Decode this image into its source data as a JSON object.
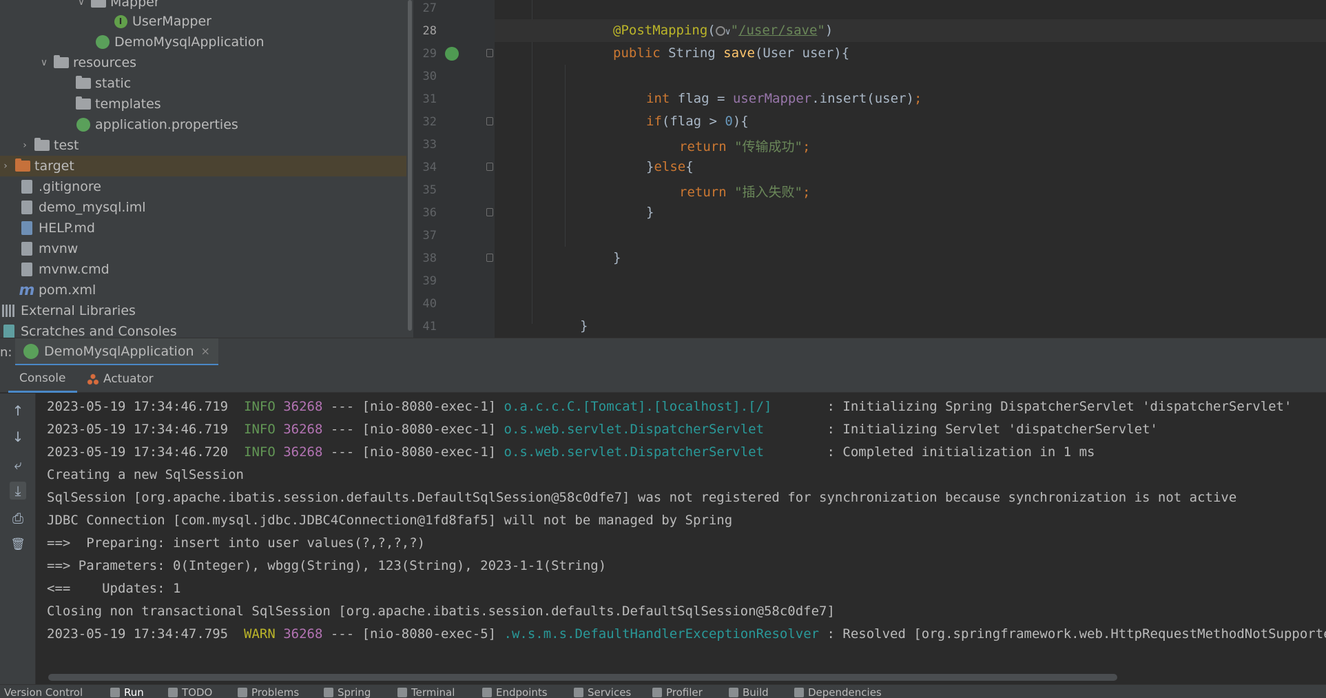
{
  "project_tree": {
    "items": [
      {
        "label": "Mapper",
        "arrow": "∨",
        "icon": "folder-icon"
      },
      {
        "label": "UserMapper",
        "arrow": "",
        "icon": "interface-icon",
        "icon_text": "I"
      },
      {
        "label": "DemoMysqlApplication",
        "arrow": "",
        "icon": "spring-boot-class-icon"
      },
      {
        "label": "resources",
        "arrow": "∨",
        "icon": "resources-folder-icon"
      },
      {
        "label": "static",
        "arrow": "",
        "icon": "folder-icon"
      },
      {
        "label": "templates",
        "arrow": "",
        "icon": "folder-icon"
      },
      {
        "label": "application.properties",
        "arrow": "",
        "icon": "spring-properties-icon"
      },
      {
        "label": "test",
        "arrow": "›",
        "icon": "folder-icon"
      },
      {
        "label": "target",
        "arrow": "›",
        "icon": "excluded-folder-icon"
      },
      {
        "label": ".gitignore",
        "arrow": "",
        "icon": "file-icon"
      },
      {
        "label": "demo_mysql.iml",
        "arrow": "",
        "icon": "file-icon"
      },
      {
        "label": "HELP.md",
        "arrow": "",
        "icon": "markdown-icon"
      },
      {
        "label": "mvnw",
        "arrow": "",
        "icon": "script-icon"
      },
      {
        "label": "mvnw.cmd",
        "arrow": "",
        "icon": "file-icon"
      },
      {
        "label": "pom.xml",
        "arrow": "",
        "icon": "maven-icon",
        "icon_text": "m"
      },
      {
        "label": "External Libraries",
        "arrow": "",
        "icon": "libraries-icon"
      },
      {
        "label": "Scratches and Consoles",
        "arrow": "",
        "icon": "scratches-icon"
      }
    ],
    "selected": "target"
  },
  "editor": {
    "line_numbers": [
      "27",
      "28",
      "29",
      "30",
      "31",
      "32",
      "33",
      "34",
      "35",
      "36",
      "37",
      "38",
      "39",
      "40",
      "41"
    ],
    "current_line": "28",
    "code": {
      "l28_annotation": "@PostMapping",
      "l28_open": "(",
      "l28_dropdown": "∨",
      "l28_quote1": "\"",
      "l28_url1": "/user/",
      "l28_url2": "save",
      "l28_quote2": "\"",
      "l28_close": ")",
      "l29_public": "public",
      "l29_type": " String ",
      "l29_method": "save",
      "l29_params": "(User user){",
      "l31_int": "int",
      "l31_rest1": " flag = ",
      "l31_field": "userMapper",
      "l31_rest2": ".insert(user)",
      "l31_semi": ";",
      "l32_if": "if",
      "l32_rest1": "(flag > ",
      "l32_num": "0",
      "l32_rest2": "){",
      "l33_return": "return",
      "l33_str": " \"传输成功\"",
      "l33_semi": ";",
      "l34_brace": "}",
      "l34_else": "else",
      "l34_open": "{",
      "l35_return": "return",
      "l35_str": " \"插入失败\"",
      "l35_semi": ";",
      "l36_brace": "}",
      "l38_brace": "}",
      "l41_brace": "}"
    }
  },
  "run_window": {
    "prefix": "n:",
    "tab_label": "DemoMysqlApplication",
    "tab_close": "×",
    "sub_tabs": [
      "Console",
      "Actuator"
    ]
  },
  "console_toolbar": {
    "up": "↑",
    "down": "↓",
    "wrap": "⤶",
    "scroll_end": "⤓",
    "print": "⎙",
    "clear": "🗑"
  },
  "console": {
    "log": [
      {
        "ts": "2023-05-19 17:34:46.719",
        "level": "INFO",
        "pid": "36268",
        "thread": " --- [nio-8080-exec-1] ",
        "logger": "o.a.c.c.C.[Tomcat].[localhost].[/]      ",
        "msg": " : Initializing Spring DispatcherServlet 'dispatcherServlet'"
      },
      {
        "ts": "2023-05-19 17:34:46.719",
        "level": "INFO",
        "pid": "36268",
        "thread": " --- [nio-8080-exec-1] ",
        "logger": "o.s.web.servlet.DispatcherServlet       ",
        "msg": " : Initializing Servlet 'dispatcherServlet'"
      },
      {
        "ts": "2023-05-19 17:34:46.720",
        "level": "INFO",
        "pid": "36268",
        "thread": " --- [nio-8080-exec-1] ",
        "logger": "o.s.web.servlet.DispatcherServlet       ",
        "msg": " : Completed initialization in 1 ms"
      }
    ],
    "plain": [
      "Creating a new SqlSession",
      "SqlSession [org.apache.ibatis.session.defaults.DefaultSqlSession@58c0dfe7] was not registered for synchronization because synchronization is not active",
      "JDBC Connection [com.mysql.jdbc.JDBC4Connection@1fd8faf5] will not be managed by Spring",
      "==>  Preparing: insert into user values(?,?,?,?)",
      "==> Parameters: 0(Integer), wbgg(String), 123(String), 2023-1-1(String)",
      "<==    Updates: 1",
      "Closing non transactional SqlSession [org.apache.ibatis.session.defaults.DefaultSqlSession@58c0dfe7]"
    ],
    "warn": {
      "ts": "2023-05-19 17:34:47.795",
      "level": " WARN",
      "pid": "36268",
      "thread": " --- [nio-8080-exec-5] ",
      "logger": ".w.s.m.s.DefaultHandlerExceptionResolver",
      "msg": " : Resolved [org.springframework.web.HttpRequestMethodNotSupportedException: Request method 'GET' not supported]"
    }
  },
  "bottom_bar": {
    "items": [
      "Version Control",
      "Run",
      "TODO",
      "Problems",
      "Spring",
      "Terminal",
      "Endpoints",
      "Services",
      "Profiler",
      "Build",
      "Dependencies"
    ],
    "active": "Run"
  }
}
